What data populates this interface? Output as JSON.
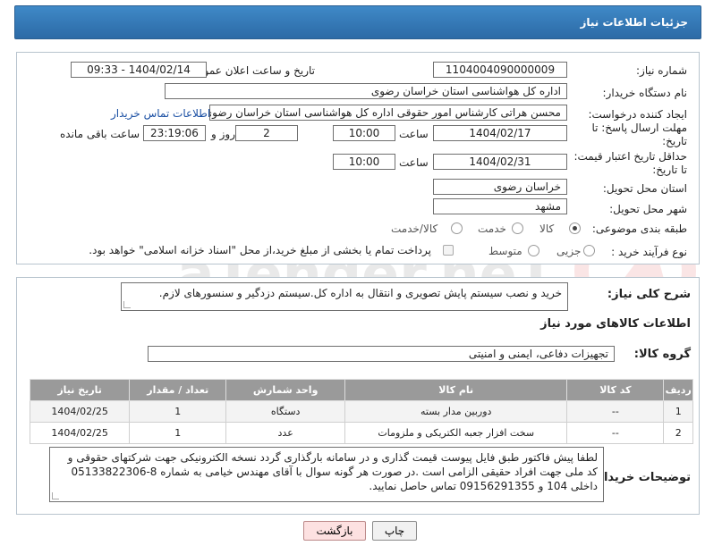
{
  "header": {
    "title": "جزئیات اطلاعات نیاز"
  },
  "form": {
    "need_number_label": "شماره نیاز:",
    "need_number": "1104004090000009",
    "announce_label": "تاریخ و ساعت اعلان عمومی:",
    "announce_value": "1404/02/14 - 09:33",
    "buyer_org_label": "نام دستگاه خریدار:",
    "buyer_org": "اداره کل هواشناسی استان خراسان رضوی",
    "creator_label": "ایجاد کننده درخواست:",
    "creator": "محسن هراتی کارشناس امور حقوقی اداره کل هواشناسی استان خراسان رضوی",
    "contact_link": "اطلاعات تماس خریدار",
    "deadline_label_1": "مهلت ارسال پاسخ: تا",
    "deadline_label_2": "تاریخ:",
    "deadline_date": "1404/02/17",
    "time_label": "ساعت",
    "deadline_time": "10:00",
    "days_value": "2",
    "days_label": "روز و",
    "remaining_time": "23:19:06",
    "remaining_label": "ساعت باقی مانده",
    "validity_label_1": "حداقل تاریخ اعتبار قیمت:",
    "validity_label_2": "تا تاریخ:",
    "validity_date": "1404/02/31",
    "validity_time": "10:00",
    "province_label": "استان محل تحویل:",
    "province": "خراسان رضوی",
    "city_label": "شهر محل تحویل:",
    "city": "مشهد",
    "category_label": "طبقه بندی موضوعی:",
    "category_options": [
      "کالا",
      "خدمت",
      "کالا/خدمت"
    ],
    "process_label": "نوع فرآیند خرید :",
    "process_options": [
      "جزیی",
      "متوسط"
    ],
    "payment_note": "پرداخت تمام یا بخشی از مبلغ خرید،از محل \"اسناد خزانه اسلامی\" خواهد بود."
  },
  "description": {
    "label": "شرح کلی نیاز:",
    "text": "خرید و نصب سیستم پایش تصویری و انتقال به اداره کل.سیستم دزدگیر و سنسورهای لازم."
  },
  "goods": {
    "section_title": "اطلاعات کالاهای مورد نیاز",
    "group_label": "گروه کالا:",
    "group_value": "تجهیزات دفاعی، ایمنی و امنیتی",
    "columns": [
      "ردیف",
      "کد کالا",
      "نام کالا",
      "واحد شمارش",
      "تعداد / مقدار",
      "تاریخ نیاز"
    ],
    "rows": [
      [
        "1",
        "--",
        "دوربین مدار بسته",
        "دستگاه",
        "1",
        "1404/02/25"
      ],
      [
        "2",
        "--",
        "سخت افزار جعبه الکتریکی و ملزومات",
        "عدد",
        "1",
        "1404/02/25"
      ]
    ]
  },
  "buyer_notes": {
    "label": "توضیحات خریدار:",
    "text": "لطفا پیش فاکتور طبق فایل پیوست قیمت گذاری و در سامانه بارگذاری گردد نسخه الکترونیکی جهت شرکتهای حقوقی و کد ملی جهت افراد حقیقی الزامی است .در صورت هر گونه سوال با آقای مهندس خیامی به شماره 8-05133822306 داخلی 104 و 09156291355 تماس حاصل نمایید."
  },
  "buttons": {
    "print": "چاپ",
    "back": "بازگشت"
  },
  "watermark": {
    "text": "AriaTender.neT"
  },
  "colors": {
    "header_bg": "#2f72b0",
    "table_header_bg": "#9a9a9a",
    "link": "#1a4fa3"
  }
}
